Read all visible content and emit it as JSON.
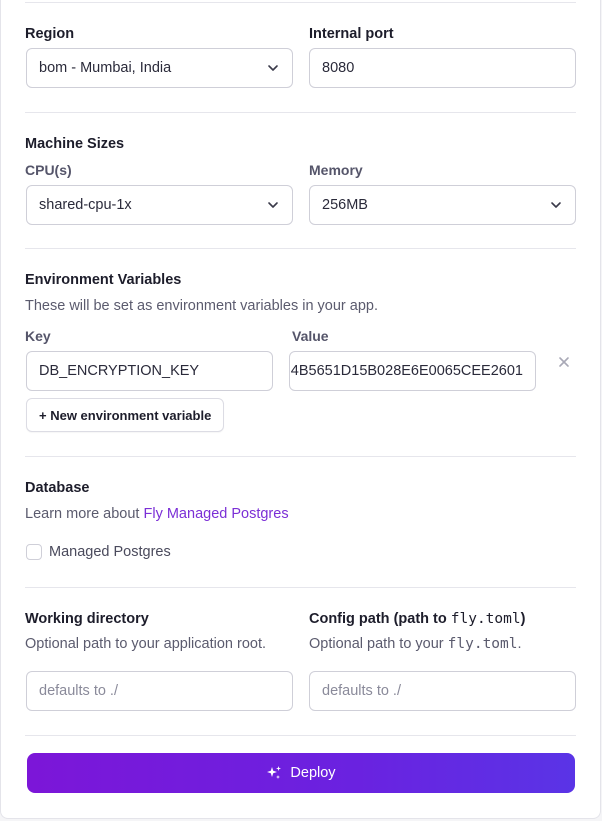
{
  "region": {
    "label": "Region",
    "value": "bom - Mumbai, India"
  },
  "internal_port": {
    "label": "Internal port",
    "value": "8080"
  },
  "machine_sizes": {
    "title": "Machine Sizes",
    "cpu": {
      "label": "CPU(s)",
      "value": "shared-cpu-1x"
    },
    "memory": {
      "label": "Memory",
      "value": "256MB"
    }
  },
  "env_vars": {
    "title": "Environment Variables",
    "description": "These will be set as environment variables in your app.",
    "key_label": "Key",
    "value_label": "Value",
    "rows": [
      {
        "key": "DB_ENCRYPTION_KEY",
        "value": "4B5651D15B028E6E0065CEE2601"
      }
    ],
    "add_button": "+ New environment variable"
  },
  "database": {
    "title": "Database",
    "learn_prefix": "Learn more about ",
    "link_text": "Fly Managed Postgres",
    "checkbox_label": "Managed Postgres",
    "checked": false
  },
  "working_directory": {
    "label": "Working directory",
    "help": "Optional path to your application root.",
    "placeholder": "defaults to ./"
  },
  "config_path": {
    "label_prefix": "Config path (path to ",
    "label_code": "fly.toml",
    "label_suffix": ")",
    "help_prefix": "Optional path to your ",
    "help_code": "fly.toml",
    "help_suffix": ".",
    "placeholder": "defaults to ./"
  },
  "deploy": {
    "label": "Deploy"
  },
  "colors": {
    "accent": "#7c16d8",
    "link": "#7b2fd6"
  },
  "icons": {
    "select": "chevron-down-icon",
    "remove": "close-icon",
    "deploy": "sparkles-icon"
  }
}
